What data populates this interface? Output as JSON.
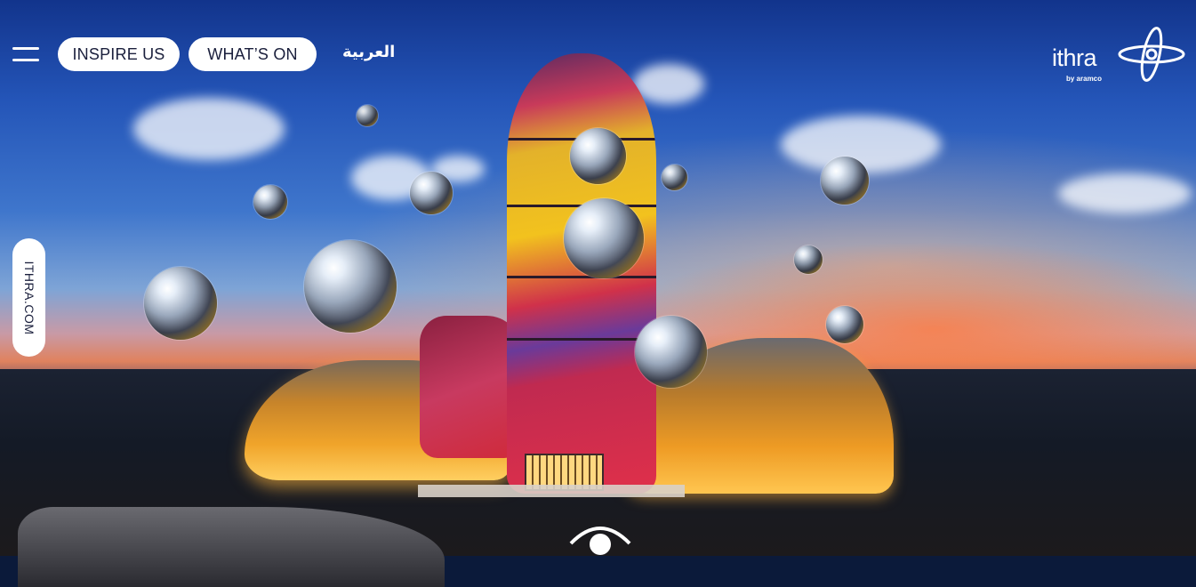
{
  "nav": {
    "menu_icon": "hamburger-menu-icon",
    "inspire_label": "INSPIRE US",
    "whats_on_label": "WHAT’S ON",
    "arabic_label": "العربية"
  },
  "logo": {
    "wordmark": "ithra",
    "byline": "by aramco",
    "icon": "ithra-logo-mark"
  },
  "side_tab": {
    "label": "ITHRA.COM"
  },
  "hero": {
    "view_icon": "eye-icon"
  },
  "colors": {
    "pill_background": "#ffffff",
    "pill_text": "#1a1f3c",
    "header_text": "#ffffff"
  }
}
